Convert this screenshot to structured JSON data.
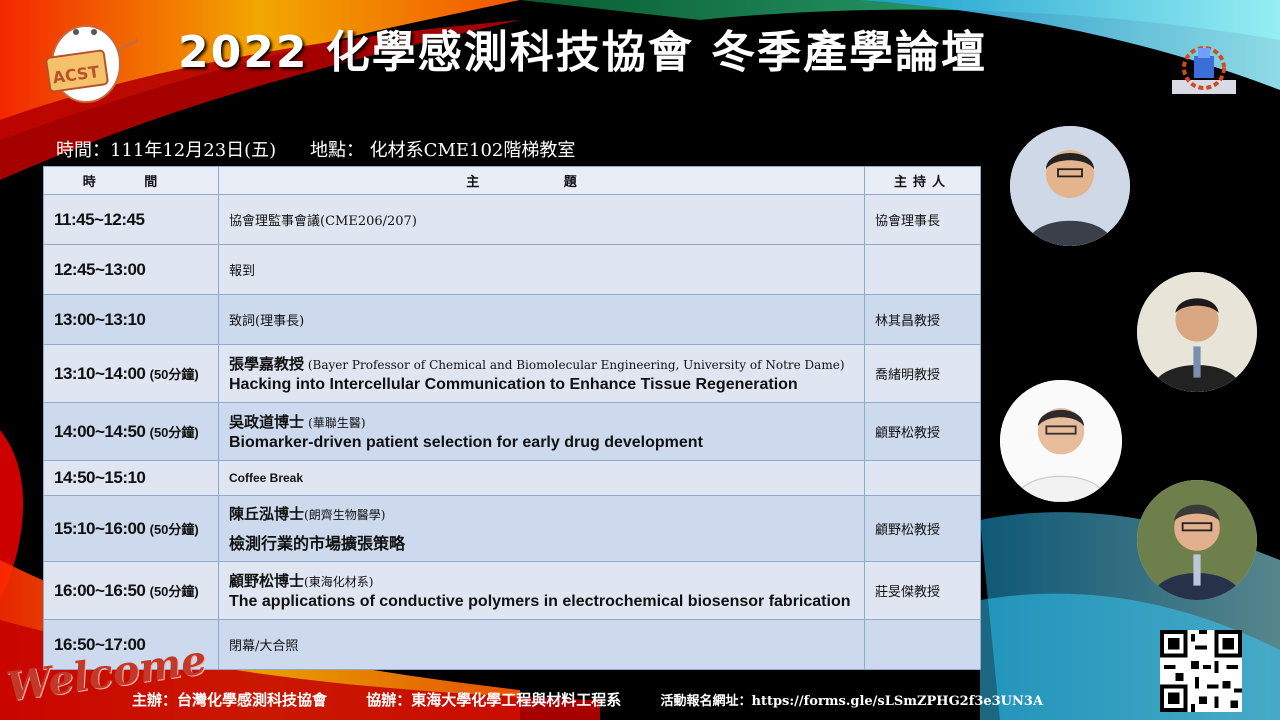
{
  "title": "2022 化學感測科技協會 冬季產學論壇",
  "info": {
    "time": "時間：111年12月23日(五)",
    "place": "地點： 化材系CME102階梯教室"
  },
  "table": {
    "headers": {
      "time": "時 間",
      "topic": "主 題",
      "host": "主持人"
    },
    "rows": [
      {
        "time": "11:45~12:45",
        "topic": "協會理監事會議(CME206/207)",
        "host": "協會理事長"
      },
      {
        "time": "12:45~13:00",
        "topic": "報到",
        "host": ""
      },
      {
        "time": "13:00~13:10",
        "topic": "致詞(理事長)",
        "host": "林其昌教授"
      },
      {
        "time": "13:10~14:00",
        "dur": "(50分鐘)",
        "speaker": "張學嘉教授",
        "aff": " (Bayer Professor of Chemical and Biomolecular Engineering, University of Notre Dame)",
        "talk": "Hacking into Intercellular Communication to Enhance Tissue Regeneration",
        "host": "喬緒明教授"
      },
      {
        "time": "14:00~14:50",
        "dur": "(50分鐘)",
        "speaker": "吳政道博士",
        "aff": "(華聯生醫)",
        "talk": "Biomarker-driven patient selection for early drug development",
        "host": "顧野松教授"
      },
      {
        "time": "14:50~15:10",
        "topic": "Coffee Break",
        "host": ""
      },
      {
        "time": "15:10~16:00",
        "dur": "(50分鐘)",
        "speaker": "陳丘泓博士",
        "aff": "(朗齊生物醫學)",
        "talk": "檢測行業的市場擴張策略",
        "host": "顧野松教授"
      },
      {
        "time": "16:00~16:50",
        "dur": "(50分鐘)",
        "speaker": "顧野松博士",
        "aff": "(東海化材系)",
        "talk": "The applications of conductive polymers in electrochemical biosensor fabrication",
        "host": "莊旻傑教授"
      },
      {
        "time": "16:50~17:00",
        "topic": "閉幕/大合照",
        "host": ""
      }
    ]
  },
  "footer": {
    "organizer": "主辦：台灣化學感測科技協會",
    "co_organizer": "協辦：東海大學化學工程與材料工程系",
    "signup": "活動報名網址：https://forms.gle/sLSmZPHG2f3e3UN3A"
  },
  "welcome_text": "Welcome",
  "logo_text": "ACST",
  "colors": {
    "table_bg": "#dfe6f2",
    "table_alt": "#cdd9ec",
    "border": "#8fa9cf"
  }
}
